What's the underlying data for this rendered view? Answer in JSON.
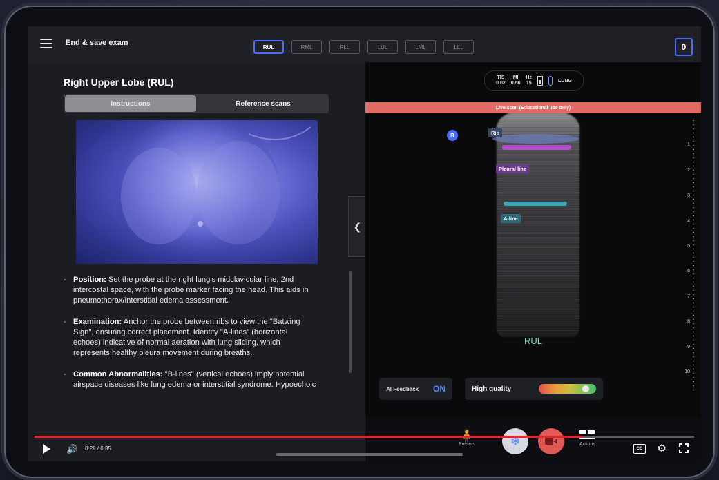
{
  "header": {
    "end_save_label": "End & save exam",
    "lobe_tabs": [
      "RUL",
      "RML",
      "RLL",
      "LUL",
      "LML",
      "LLL"
    ],
    "active_lobe": "RUL",
    "count": "0"
  },
  "left_panel": {
    "title": "Right Upper Lobe (RUL)",
    "segments": [
      "Instructions",
      "Reference scans"
    ],
    "active_segment": "Instructions",
    "instructions": [
      {
        "heading": "Position:",
        "text": " Set the probe at the right lung's midclavicular line, 2nd intercostal space, with the probe marker facing the head. This aids in pneumothorax/interstitial edema assessment."
      },
      {
        "heading": "Examination:",
        "text": " Anchor the probe between ribs to view the \"Batwing Sign\", ensuring correct placement. Identify \"A-lines\" (horizontal echoes) indicative of normal aeration with lung sliding, which represents healthy pleura movement during breaths."
      },
      {
        "heading": "Common Abnormalities:",
        "text": " \"B-lines\" (vertical echoes) imply potential airspace diseases like lung edema or interstitial syndrome. Hypoechoic areas within the pleura can signal"
      }
    ]
  },
  "scan": {
    "params": {
      "tis_label": "TIS",
      "tis_value": "0.02",
      "mi_label": "MI",
      "mi_value": "0.56",
      "hz_label": "Hz",
      "hz_value": "15",
      "mode": "LUNG"
    },
    "banner": "Live scan (Educational use only)",
    "b_badge": "B",
    "labels": {
      "rib": "Rib",
      "pleural": "Pleural line",
      "aline": "A-line"
    },
    "region_label": "RUL",
    "depth_ticks": [
      "1",
      "2",
      "3",
      "4",
      "5",
      "6",
      "7",
      "8",
      "9",
      "10"
    ],
    "ai_feedback_label": "AI Feedback",
    "ai_feedback_value": "ON",
    "quality_label": "High quality",
    "quality_level": 0.9,
    "tools": {
      "presets": "Presets",
      "actions": "Actions"
    }
  },
  "player": {
    "time": "0:29 / 0:35",
    "progress": 0.83,
    "cc": "CC"
  },
  "colors": {
    "accent": "#4a6cff",
    "banner": "#e06b65",
    "pleural": "#c44fe0",
    "aline": "#3ec7d8",
    "progress": "#e02828"
  }
}
